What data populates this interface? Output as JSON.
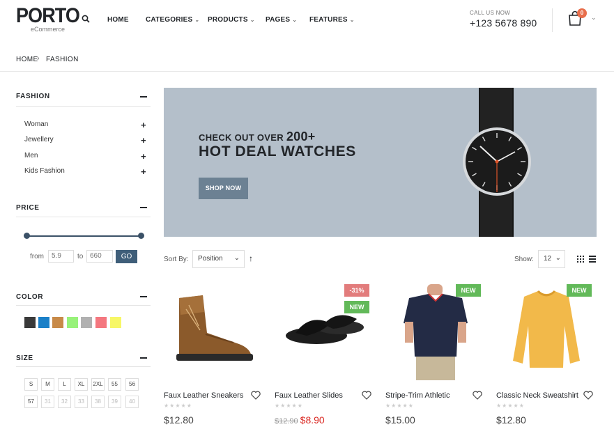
{
  "header": {
    "logo": "PORTO",
    "logo_sub": "eCommerce",
    "nav": [
      "HOME",
      "CATEGORIES",
      "PRODUCTS",
      "PAGES",
      "FEATURES"
    ],
    "call_us": "CALL US NOW",
    "phone": "+123 5678 890",
    "cart_count": "0"
  },
  "breadcrumb": [
    "HOME",
    "FASHION"
  ],
  "sidebar": {
    "fashion_title": "FASHION",
    "categories": [
      "Woman",
      "Jewellery",
      "Men",
      "Kids Fashion"
    ],
    "price_title": "PRICE",
    "price_from_label": "from",
    "price_from": "5.9",
    "price_to_label": "to",
    "price_to": "660",
    "go_label": "GO",
    "color_title": "COLOR",
    "colors": [
      "#3a3a3a",
      "#1b80c8",
      "#c88a48",
      "#98f27a",
      "#b1b1b1",
      "#f4777f",
      "#f7f766"
    ],
    "size_title": "SIZE",
    "sizes": [
      "S",
      "M",
      "L",
      "XL",
      "2XL",
      "55",
      "56",
      "57",
      "31",
      "32",
      "33",
      "38",
      "39",
      "40"
    ]
  },
  "banner": {
    "line1_prefix": "CHECK OUT OVER",
    "line1_number": "200+",
    "line2": "HOT DEAL WATCHES",
    "button": "SHOP NOW"
  },
  "toolbar": {
    "sort_label": "Sort By:",
    "sort_value": "Position",
    "show_label": "Show:",
    "show_value": "12"
  },
  "products": [
    {
      "name": "Faux Leather Sneakers",
      "price": "$12.80",
      "badges": []
    },
    {
      "name": "Faux Leather Slides",
      "old_price": "$12.90",
      "price": "$8.90",
      "badges": [
        "-31%",
        "NEW"
      ]
    },
    {
      "name": "Stripe-Trim Athletic",
      "price": "$15.00",
      "badges": [
        "NEW"
      ]
    },
    {
      "name": "Classic Neck Sweatshirt",
      "price": "$12.80",
      "badges": [
        "NEW"
      ]
    }
  ],
  "badge_colors": {
    "sale": "#e27c7c",
    "new": "#62b959"
  }
}
